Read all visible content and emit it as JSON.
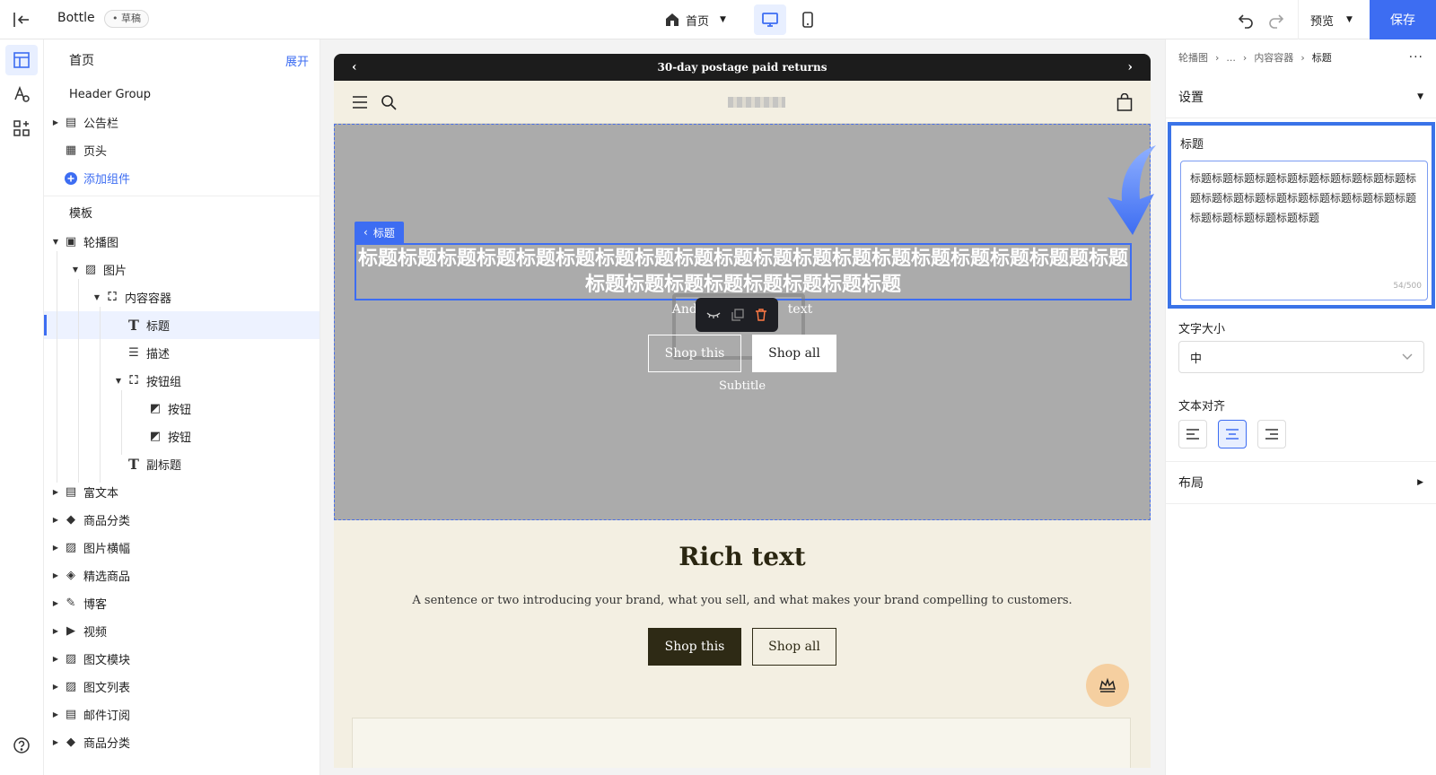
{
  "topbar": {
    "app_name": "Bottle",
    "draft_badge": "• 草稿",
    "page_select": "首页",
    "preview_label": "预览",
    "save_label": "保存"
  },
  "tree": {
    "title": "首页",
    "expand_label": "展开",
    "header_group_label": "Header Group",
    "header_items": [
      {
        "label": "公告栏",
        "icon": "announcement-icon"
      },
      {
        "label": "页头",
        "icon": "header-icon"
      }
    ],
    "add_component_label": "添加组件",
    "template_label": "模板",
    "template_items": [
      {
        "label": "轮播图",
        "icon": "carousel-icon"
      },
      {
        "label": "图片",
        "icon": "image-icon"
      },
      {
        "label": "内容容器",
        "icon": "container-icon"
      },
      {
        "label": "标题",
        "icon": "text-icon"
      },
      {
        "label": "描述",
        "icon": "paragraph-icon"
      },
      {
        "label": "按钮组",
        "icon": "container-icon"
      },
      {
        "label": "按钮",
        "icon": "button-icon"
      },
      {
        "label": "按钮",
        "icon": "button-icon"
      },
      {
        "label": "副标题",
        "icon": "text-icon"
      },
      {
        "label": "富文本",
        "icon": "richtext-icon"
      },
      {
        "label": "商品分类",
        "icon": "tag-icon"
      },
      {
        "label": "图片横幅",
        "icon": "banner-icon"
      },
      {
        "label": "精选商品",
        "icon": "tags-icon"
      },
      {
        "label": "博客",
        "icon": "blog-icon"
      },
      {
        "label": "视频",
        "icon": "video-icon"
      },
      {
        "label": "图文模块",
        "icon": "image-text-icon"
      },
      {
        "label": "图文列表",
        "icon": "image-list-icon"
      },
      {
        "label": "邮件订阅",
        "icon": "mail-icon"
      },
      {
        "label": "商品分类",
        "icon": "tag-icon"
      }
    ]
  },
  "canvas": {
    "announcement": "30-day postage paid returns",
    "hero": {
      "tag_label": "标题",
      "title": "标题标题标题标题标题标题标题标题标题标题标题标题标题标题标题标题标题标题题标题标题标题标题标题标题标题标题标题",
      "subtext_left": "And",
      "subtext_right": "text",
      "button1": "Shop this",
      "button2": "Shop all",
      "subtitle": "Subtitle"
    },
    "rich": {
      "title": "Rich text",
      "description": "A sentence or two introducing your brand, what you sell, and what makes your brand compelling to customers.",
      "button1": "Shop this",
      "button2": "Shop all"
    }
  },
  "panel": {
    "breadcrumb": [
      "轮播图",
      "...",
      "内容容器",
      "标题"
    ],
    "settings_label": "设置",
    "title_field_label": "标题",
    "title_value": "标题标题标题标题标题标题标题标题标题标题标题标题标题标题标题标题标题标题标题标题标题标题标题标题标题标题标题",
    "char_count": "54/500",
    "font_size_label": "文字大小",
    "font_size_value": "中",
    "align_label": "文本对齐",
    "align_selected": "center",
    "layout_label": "布局"
  },
  "colors": {
    "accent": "#3d6df2",
    "hero_bg": "#ababab",
    "store_bg": "#f3efe2",
    "dark_button": "#2e2a15"
  }
}
